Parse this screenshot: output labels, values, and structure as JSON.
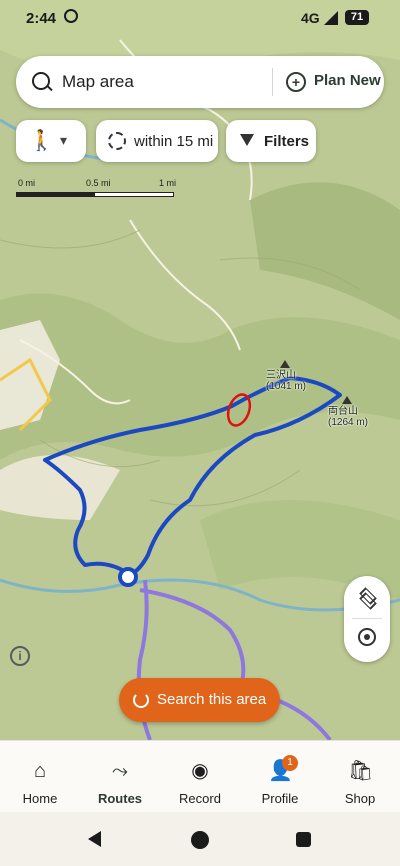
{
  "status_bar": {
    "time": "2:44",
    "network": "4G",
    "battery": "71"
  },
  "search": {
    "placeholder": "Map area",
    "plan_label": "Plan New"
  },
  "filters": {
    "activity_icon": "hiking-icon",
    "distance_label": "within 15 mi",
    "filters_label": "Filters"
  },
  "scale": {
    "labels": [
      "0 mi",
      "0.5 mi",
      "1 mi"
    ]
  },
  "map": {
    "peaks": [
      {
        "name": "三沢山",
        "elevation": "(1041 m)"
      },
      {
        "name": "両台山",
        "elevation": "(1264 m)"
      }
    ],
    "colors": {
      "route": "#1c49c2",
      "alt_route": "#9a86e6",
      "annotation": "#e01010",
      "terrain": "#b8c98e"
    }
  },
  "search_area_label": "Search this area",
  "nav": {
    "items": [
      {
        "label": "Home",
        "icon": "home-icon"
      },
      {
        "label": "Routes",
        "icon": "routes-icon"
      },
      {
        "label": "Record",
        "icon": "record-icon"
      },
      {
        "label": "Profile",
        "icon": "profile-icon"
      },
      {
        "label": "Shop",
        "icon": "shop-icon"
      }
    ],
    "profile_badge": "1",
    "active": "Routes"
  }
}
